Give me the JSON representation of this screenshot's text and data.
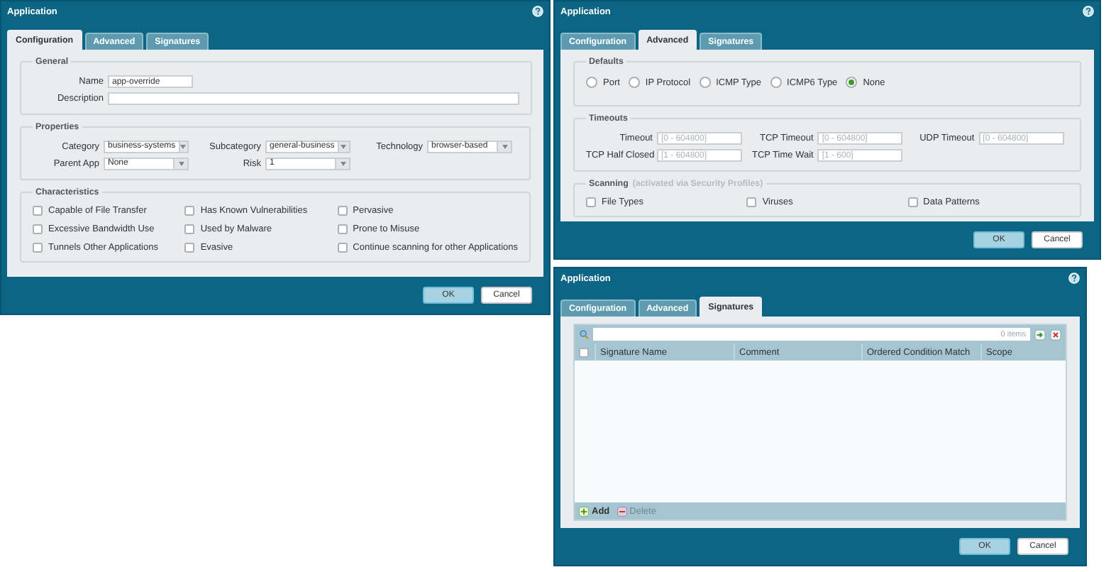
{
  "dialogs": [
    {
      "title": "Application",
      "tabs": [
        {
          "label": "Configuration",
          "selected": true
        },
        {
          "label": "Advanced",
          "selected": false
        },
        {
          "label": "Signatures",
          "selected": false
        }
      ],
      "sections": [
        {
          "kind": "stacked",
          "legend": "General",
          "fields": [
            {
              "kind": "text",
              "label": "Name",
              "value": "app-override"
            },
            {
              "kind": "wide_text",
              "label": "Description"
            }
          ]
        },
        {
          "kind": "grid",
          "legend": "Properties",
          "fields": [
            {
              "kind": "select",
              "label": "Category",
              "value": "business-systems"
            },
            {
              "kind": "select",
              "label": "Subcategory",
              "value": "general-business"
            },
            {
              "kind": "select",
              "label": "Technology",
              "value": "browser-based"
            },
            {
              "kind": "select",
              "label": "Parent App",
              "value": "None"
            },
            {
              "kind": "select",
              "label": "Risk",
              "value": "1"
            }
          ]
        },
        {
          "kind": "checkboxes",
          "legend": "Characteristics",
          "options": [
            {
              "label": "Capable of File Transfer",
              "checked": false
            },
            {
              "label": "Has Known Vulnerabilities",
              "checked": false
            },
            {
              "label": "Pervasive",
              "checked": false
            },
            {
              "label": "Excessive Bandwidth Use",
              "checked": false
            },
            {
              "label": "Used by Malware",
              "checked": false
            },
            {
              "label": "Prone to Misuse",
              "checked": false
            },
            {
              "label": "Tunnels Other Applications",
              "checked": false
            },
            {
              "label": "Evasive",
              "checked": false
            },
            {
              "label": "Continue scanning for other Applications",
              "checked": false
            }
          ]
        }
      ],
      "buttons": [
        {
          "label": "OK",
          "kind": "primary"
        },
        {
          "label": "Cancel",
          "kind": "secondary"
        }
      ]
    },
    {
      "title": "Application",
      "tabs": [
        {
          "label": "Configuration",
          "selected": false
        },
        {
          "label": "Advanced",
          "selected": true
        },
        {
          "label": "Signatures",
          "selected": false
        }
      ],
      "sections": [
        {
          "kind": "radios",
          "legend": "Defaults",
          "options": [
            {
              "label": "Port",
              "selected": false
            },
            {
              "label": "IP Protocol",
              "selected": false
            },
            {
              "label": "ICMP Type",
              "selected": false
            },
            {
              "label": "ICMP6 Type",
              "selected": false
            },
            {
              "label": "None",
              "selected": true
            }
          ]
        },
        {
          "kind": "grid",
          "legend": "Timeouts",
          "fields": [
            {
              "kind": "text",
              "label": "Timeout",
              "placeholder": "[0 - 604800]"
            },
            {
              "kind": "text",
              "label": "TCP Timeout",
              "placeholder": "[0 - 604800]"
            },
            {
              "kind": "text",
              "label": "UDP Timeout",
              "placeholder": "[0 - 604800]"
            },
            {
              "kind": "text",
              "label": "TCP Half Closed",
              "placeholder": "[1 - 604800]"
            },
            {
              "kind": "text",
              "label": "TCP Time Wait",
              "placeholder": "[1 - 600]"
            }
          ]
        },
        {
          "kind": "checkboxes",
          "legend": "Scanning",
          "note": "(activated via Security Profiles)",
          "options": [
            {
              "label": "File Types",
              "checked": false
            },
            {
              "label": "Viruses",
              "checked": false
            },
            {
              "label": "Data Patterns",
              "checked": false
            }
          ]
        }
      ],
      "buttons": [
        {
          "label": "OK",
          "kind": "primary"
        },
        {
          "label": "Cancel",
          "kind": "secondary"
        }
      ]
    },
    {
      "title": "Application",
      "tabs": [
        {
          "label": "Configuration",
          "selected": false
        },
        {
          "label": "Advanced",
          "selected": false
        },
        {
          "label": "Signatures",
          "selected": true
        }
      ],
      "sections": [
        {
          "kind": "table",
          "count": "0 items",
          "select_all": {
            "checked": false
          },
          "columns": [
            "Signature Name",
            "Comment",
            "Ordered Condition Match",
            "Scope"
          ],
          "actions": [
            {
              "kind": "add",
              "label": "Add",
              "disabled": false
            },
            {
              "kind": "delete",
              "label": "Delete",
              "disabled": true
            }
          ]
        }
      ],
      "buttons": [
        {
          "label": "OK",
          "kind": "primary"
        },
        {
          "label": "Cancel",
          "kind": "secondary"
        }
      ]
    }
  ]
}
